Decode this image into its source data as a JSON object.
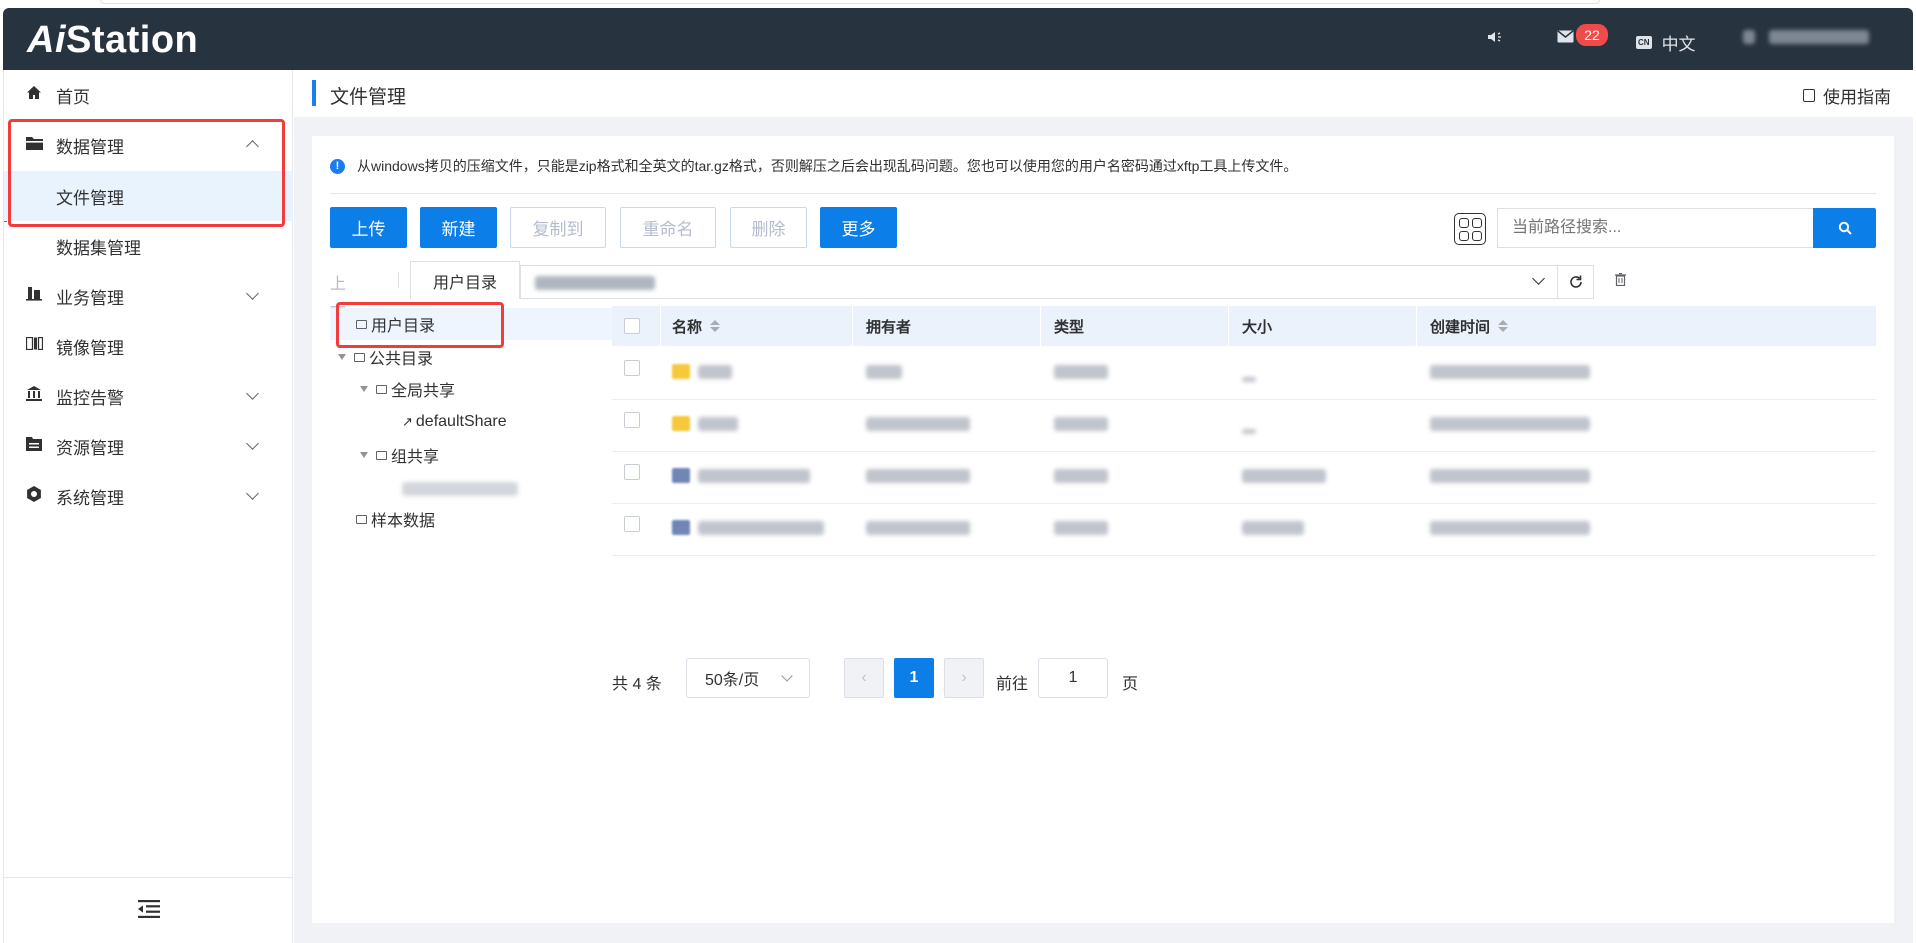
{
  "header": {
    "logo_prefix": "Ai",
    "logo_suffix": "Station",
    "mail_badge": "22",
    "lang_code": "CN",
    "lang_label": "中文"
  },
  "sidebar": {
    "items": [
      {
        "label": "首页",
        "icon": "home-icon"
      },
      {
        "label": "数据管理",
        "icon": "folder-icon"
      },
      {
        "label": "文件管理"
      },
      {
        "label": "数据集管理"
      },
      {
        "label": "业务管理",
        "icon": "business-icon"
      },
      {
        "label": "镜像管理",
        "icon": "image-icon"
      },
      {
        "label": "监控告警",
        "icon": "monitor-icon"
      },
      {
        "label": "资源管理",
        "icon": "resource-icon"
      },
      {
        "label": "系统管理",
        "icon": "system-icon"
      }
    ]
  },
  "page": {
    "title": "文件管理",
    "guide": "使用指南",
    "notice": "从windows拷贝的压缩文件，只能是zip格式和全英文的tar.gz格式，否则解压之后会出现乱码问题。您也可以使用您的用户名密码通过xftp工具上传文件。"
  },
  "toolbar": {
    "upload": "上传",
    "create": "新建",
    "copy_to": "复制到",
    "rename": "重命名",
    "delete": "删除",
    "more": "更多",
    "search_placeholder": "当前路径搜索..."
  },
  "path": {
    "up": "上一级",
    "tab": "用户目录"
  },
  "tree": {
    "user_dir": "用户目录",
    "public_dir": "公共目录",
    "global_share": "全局共享",
    "default_share": "defaultShare",
    "group_share": "组共享",
    "sample_data": "样本数据"
  },
  "table": {
    "columns": [
      "名称",
      "拥有者",
      "类型",
      "大小",
      "创建时间"
    ]
  },
  "pagination": {
    "total": "共 4 条",
    "page_size": "50条/页",
    "current": "1",
    "goto_label": "前往",
    "goto_value": "1",
    "page_suffix": "页"
  },
  "colors": {
    "header_bg": "#283340",
    "accent": "#0c7ee8",
    "highlight_box": "#f23b3b",
    "badge": "#f04b4b"
  }
}
